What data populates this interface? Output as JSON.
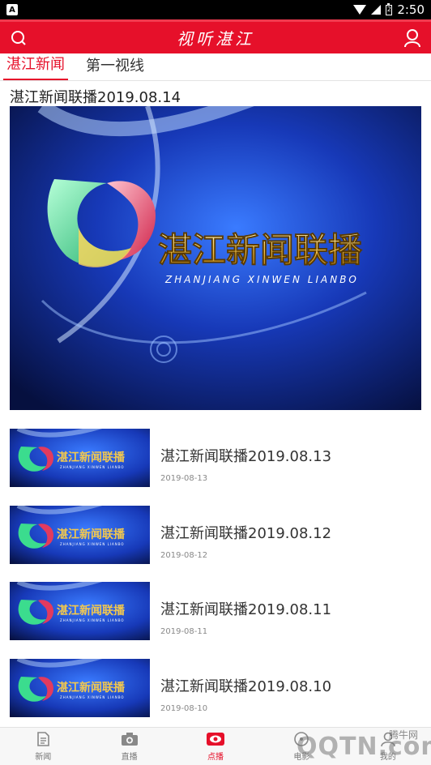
{
  "status_bar": {
    "app_badge": "A",
    "time": "2:50",
    "battery_level": "2"
  },
  "header": {
    "title": "视听湛江",
    "search_icon": "search-icon",
    "user_icon": "user-icon",
    "bg_color": "#e6102a"
  },
  "tabs": [
    {
      "label": "湛江新闻",
      "active": true
    },
    {
      "label": "第一视线",
      "active": false
    }
  ],
  "feature": {
    "title": "湛江新闻联播2019.08.14",
    "thumb_caption": "湛江新闻联播",
    "thumb_subcaption": "ZHANJIANG XINWEN LIANBO"
  },
  "list": [
    {
      "title": "湛江新闻联播2019.08.13",
      "date": "2019-08-13",
      "caption": "湛江新闻联播",
      "subcaption": "ZHANJIANG XINWEN LIANBO"
    },
    {
      "title": "湛江新闻联播2019.08.12",
      "date": "2019-08-12",
      "caption": "湛江新闻联播",
      "subcaption": "ZHANJIANG XINWEN LIANBO"
    },
    {
      "title": "湛江新闻联播2019.08.11",
      "date": "2019-08-11",
      "caption": "湛江新闻联播",
      "subcaption": "ZHANJIANG XINWEN LIANBO"
    },
    {
      "title": "湛江新闻联播2019.08.10",
      "date": "2019-08-10",
      "caption": "湛江新闻联播",
      "subcaption": "ZHANJIANG XINWEN LIANBO"
    }
  ],
  "bottom_nav": [
    {
      "label": "新闻",
      "icon": "document-icon",
      "active": false
    },
    {
      "label": "直播",
      "icon": "camera-icon",
      "active": false
    },
    {
      "label": "点播",
      "icon": "eye-icon",
      "active": true
    },
    {
      "label": "电影",
      "icon": "film-icon",
      "active": false
    },
    {
      "label": "我的",
      "icon": "user-icon",
      "active": false
    }
  ],
  "watermark": {
    "text": "QQTN.com",
    "small": "腾牛网"
  }
}
